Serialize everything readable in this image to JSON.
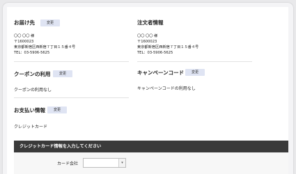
{
  "delivery": {
    "heading": "お届け先",
    "change_label": "変更",
    "name": "〇〇 〇〇 様",
    "postal": "〒1600023",
    "address": "東京都新宿区西新宿７丁目１５番４号",
    "tel": "TEL：03-5906-5625"
  },
  "orderer": {
    "heading": "注文者情報",
    "name": "〇〇 〇〇 様",
    "postal": "〒1600023",
    "address": "東京都新宿区西新宿７丁目１５番４号",
    "tel": "TEL：03-5906-5625"
  },
  "coupon": {
    "heading": "クーポンの利用",
    "change_label": "変更",
    "status": "クーポンの利用なし"
  },
  "campaign": {
    "heading": "キャンペーンコード",
    "change_label": "変更",
    "status": "キャンペーンコードの利用なし"
  },
  "payment": {
    "heading": "お支払い情報",
    "change_label": "変更",
    "method": "クレジットカード"
  },
  "card_form": {
    "bar_title": "クレジットカード情報を入力してください",
    "company_label": "カード会社",
    "company_value": ""
  },
  "colors": {
    "change_button_bg": "#dfe4f3",
    "form_bar_bg": "#3a3a3a"
  }
}
